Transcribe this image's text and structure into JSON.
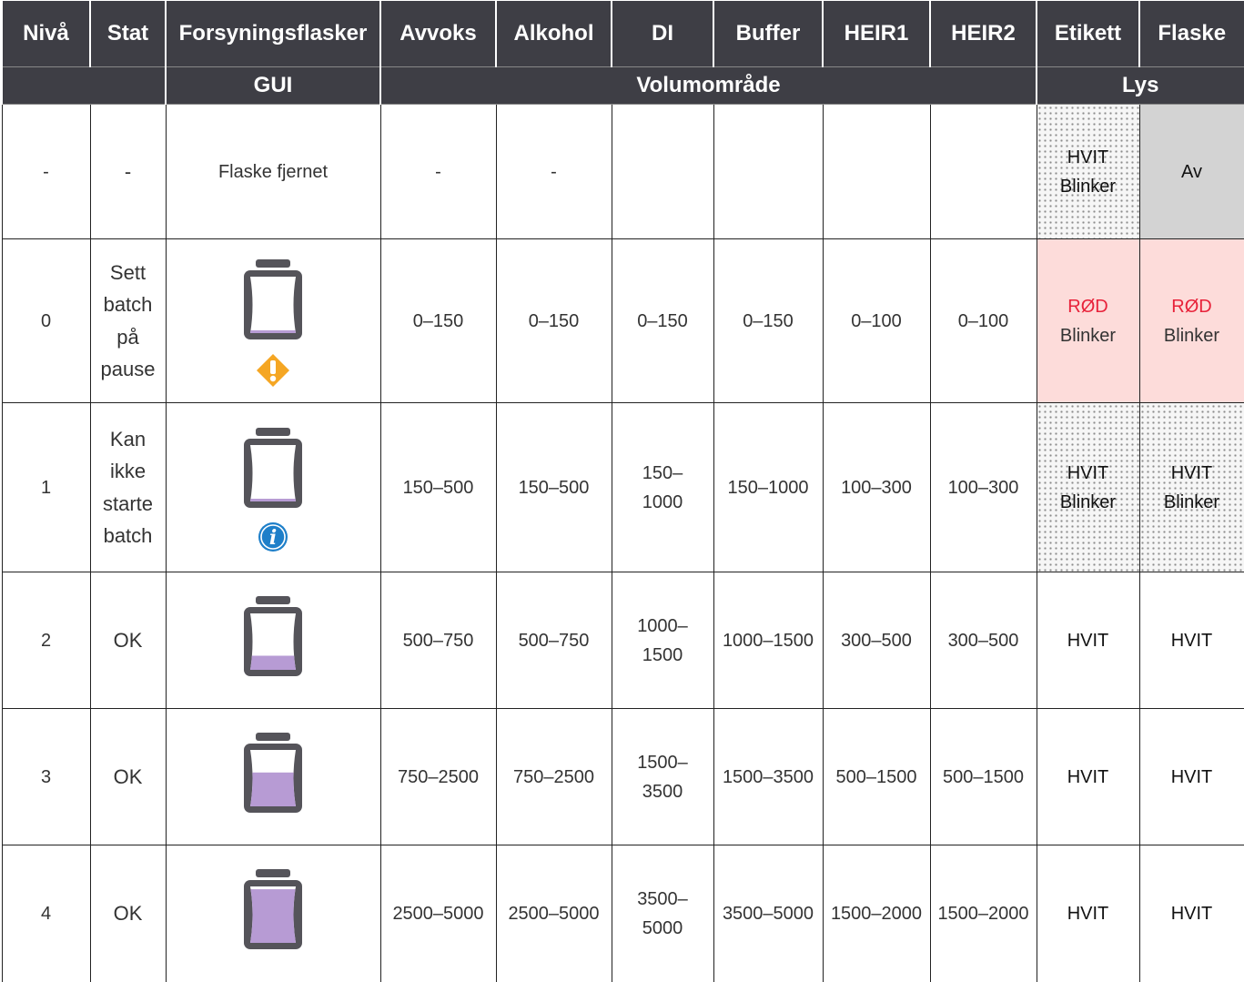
{
  "headers": {
    "niva": "Nivå",
    "stat": "Stat",
    "forsyningsflasker": "Forsyningsflasker",
    "avvoks": "Avvoks",
    "alkohol": "Alkohol",
    "di": "DI",
    "buffer": "Buffer",
    "heir1": "HEIR1",
    "heir2": "HEIR2",
    "etikett": "Etikett",
    "flaske": "Flaske"
  },
  "subheaders": {
    "gui": "GUI",
    "volumomrade": "Volumområde",
    "lys": "Lys"
  },
  "colors": {
    "header_bg": "#3e3e45",
    "red_text": "#e8223a",
    "pink_bg": "#fddcda",
    "grey_bg": "#d3d3d3",
    "liquid": "#b79bd4",
    "bottle_frame": "#55545a",
    "warning": "#f5a623",
    "info": "#1e7fc9"
  },
  "rows": [
    {
      "niva": "-",
      "stat": "-",
      "gui_text": "Flaske fjernet",
      "avvoks": "-",
      "alkohol": "-",
      "di": "",
      "buffer": "",
      "heir1": "",
      "heir2": "",
      "etikett": {
        "line1": "HVIT",
        "line2": "Blinker"
      },
      "flaske": {
        "line1": "Av"
      }
    },
    {
      "niva": "0",
      "stat": "Sett batch på pause",
      "gui_icon": "warning-diamond-icon",
      "fill_fraction": 0.05,
      "avvoks": "0–150",
      "alkohol": "0–150",
      "di": "0–150",
      "buffer": "0–150",
      "heir1": "0–100",
      "heir2": "0–100",
      "etikett": {
        "line1": "RØD",
        "line2": "Blinker"
      },
      "flaske": {
        "line1": "RØD",
        "line2": "Blinker"
      }
    },
    {
      "niva": "1",
      "stat": "Kan ikke starte batch",
      "gui_icon": "info-icon",
      "fill_fraction": 0.03,
      "avvoks": "150–500",
      "alkohol": "150–500",
      "di": "150–1000",
      "buffer": "150–1000",
      "heir1": "100–300",
      "heir2": "100–300",
      "etikett": {
        "line1": "HVIT",
        "line2": "Blinker"
      },
      "flaske": {
        "line1": "HVIT",
        "line2": "Blinker"
      }
    },
    {
      "niva": "2",
      "stat": "OK",
      "fill_fraction": 0.25,
      "avvoks": "500–750",
      "alkohol": "500–750",
      "di": "1000–1500",
      "buffer": "1000–1500",
      "heir1": "300–500",
      "heir2": "300–500",
      "etikett": {
        "line1": "HVIT"
      },
      "flaske": {
        "line1": "HVIT"
      }
    },
    {
      "niva": "3",
      "stat": "OK",
      "fill_fraction": 0.6,
      "avvoks": "750–2500",
      "alkohol": "750–2500",
      "di": "1500–3500",
      "buffer": "1500–3500",
      "heir1": "500–1500",
      "heir2": "500–1500",
      "etikett": {
        "line1": "HVIT"
      },
      "flaske": {
        "line1": "HVIT"
      }
    },
    {
      "niva": "4",
      "stat": "OK",
      "fill_fraction": 0.95,
      "avvoks": "2500–5000",
      "alkohol": "2500–5000",
      "di": "3500–5000",
      "buffer": "3500–5000",
      "heir1": "1500–2000",
      "heir2": "1500–2000",
      "etikett": {
        "line1": "HVIT"
      },
      "flaske": {
        "line1": "HVIT"
      }
    }
  ]
}
